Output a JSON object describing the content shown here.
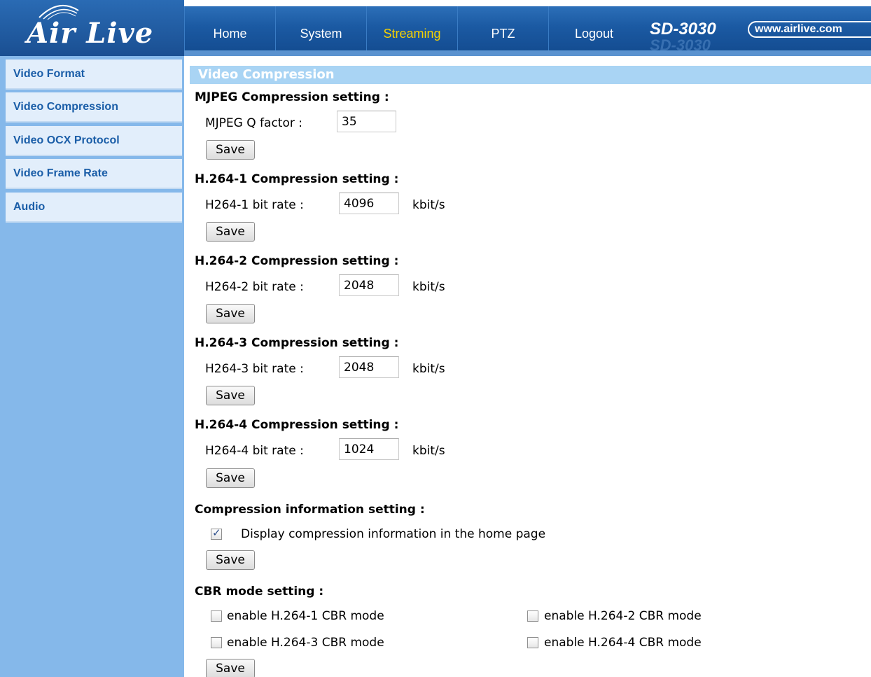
{
  "header": {
    "logo_text": "Air Live",
    "model": "SD-3030",
    "website": "www.airlive.com",
    "nav": [
      {
        "label": "Home"
      },
      {
        "label": "System"
      },
      {
        "label": "Streaming"
      },
      {
        "label": "PTZ"
      },
      {
        "label": "Logout"
      }
    ],
    "active_nav": "Streaming"
  },
  "sidebar": {
    "items": [
      {
        "label": "Video Format"
      },
      {
        "label": "Video Compression"
      },
      {
        "label": "Video OCX Protocol"
      },
      {
        "label": "Video Frame Rate"
      },
      {
        "label": "Audio"
      }
    ]
  },
  "main": {
    "title": "Video Compression",
    "save_label": "Save",
    "mjpeg": {
      "heading": "MJPEG Compression setting :",
      "label": "MJPEG Q factor :",
      "value": "35"
    },
    "h264": [
      {
        "heading": "H.264-1 Compression setting :",
        "label": "H264-1 bit rate :",
        "value": "4096",
        "unit": "kbit/s"
      },
      {
        "heading": "H.264-2 Compression setting :",
        "label": "H264-2 bit rate :",
        "value": "2048",
        "unit": "kbit/s"
      },
      {
        "heading": "H.264-3 Compression setting :",
        "label": "H264-3 bit rate :",
        "value": "2048",
        "unit": "kbit/s"
      },
      {
        "heading": "H.264-4 Compression setting :",
        "label": "H264-4 bit rate :",
        "value": "1024",
        "unit": "kbit/s"
      }
    ],
    "info": {
      "heading": "Compression information setting :",
      "checkbox_label": "Display compression information in the home page",
      "checked": true
    },
    "cbr": {
      "heading": "CBR mode setting :",
      "options": [
        {
          "label": "enable H.264-1 CBR mode",
          "checked": false
        },
        {
          "label": "enable H.264-2 CBR mode",
          "checked": false
        },
        {
          "label": "enable H.264-3 CBR mode",
          "checked": false
        },
        {
          "label": "enable H.264-4 CBR mode",
          "checked": false
        }
      ]
    }
  }
}
